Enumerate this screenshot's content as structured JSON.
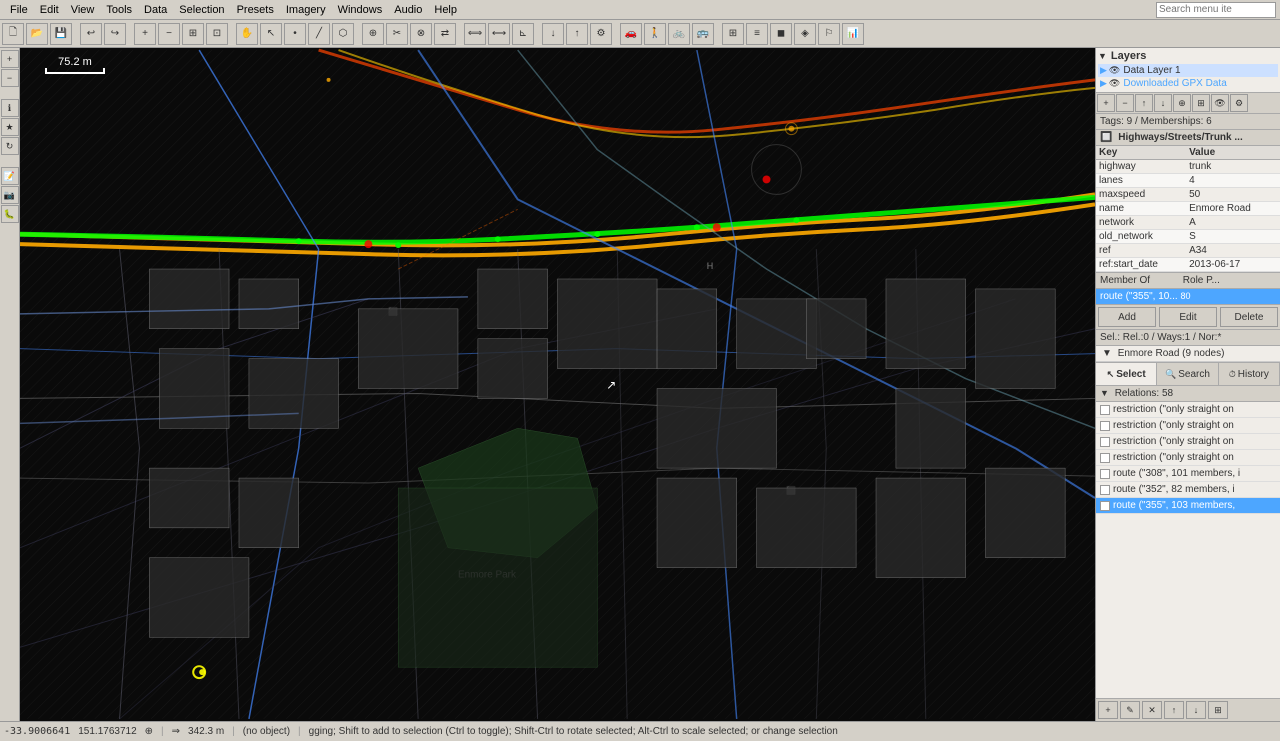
{
  "menubar": {
    "items": [
      "File",
      "Edit",
      "View",
      "Tools",
      "Data",
      "Selection",
      "Presets",
      "Imagery",
      "Windows",
      "Audio",
      "Help"
    ],
    "search_placeholder": "Search menu ite"
  },
  "toolbar": {
    "buttons": [
      "new",
      "open",
      "save",
      "undo",
      "redo",
      "zoom-in",
      "zoom-out",
      "zoom-fit",
      "zoom-sel",
      "hand",
      "select",
      "node",
      "way",
      "relation",
      "merge",
      "split",
      "combine",
      "reverse",
      "align-h",
      "align-v",
      "distribute",
      "ortho",
      "download",
      "upload",
      "preferences",
      "imagery",
      "validator",
      "paintroller",
      "car",
      "pedestrian",
      "bicycle",
      "bus",
      "barrier",
      "icon1",
      "icon2",
      "icon3",
      "icon4",
      "icon5",
      "icon6"
    ]
  },
  "left_toolbar": {
    "buttons": [
      "zoom-in",
      "zoom-out",
      "info",
      "bookmark",
      "rotate",
      "note",
      "photo",
      "bug"
    ]
  },
  "scale": {
    "value": "75.2 m"
  },
  "right_panel": {
    "layers_label": "Layers",
    "layer1": "Data Layer 1",
    "layer2": "Downloaded GPX Data",
    "tags_label": "Tags: 9 / Memberships: 6",
    "highway_label": "Highways/Streets/Trunk ...",
    "properties": [
      {
        "key": "highway",
        "value": "trunk"
      },
      {
        "key": "lanes",
        "value": "4"
      },
      {
        "key": "maxspeed",
        "value": "50"
      },
      {
        "key": "name",
        "value": "Enmore Road"
      },
      {
        "key": "network",
        "value": "A"
      },
      {
        "key": "old_network",
        "value": "S"
      },
      {
        "key": "ref",
        "value": "A34"
      },
      {
        "key": "ref:start_date",
        "value": "2013-06-17"
      }
    ],
    "member_of_label": "Member Of",
    "role_label": "Role P...",
    "member_item": "route (\"355\", 10...",
    "member_value": "80",
    "add_label": "Add",
    "edit_label": "Edit",
    "delete_label": "Delete",
    "sel_info": "Sel.: Rel.:0 / Ways:1 / Nor:*",
    "enmore_road": "Enmore Road (9 nodes)",
    "tabs": {
      "select": "Select",
      "search": "Search",
      "history": "History"
    },
    "relations_label": "Relations: 58",
    "relations": [
      {
        "text": "restriction (\"only straight on",
        "selected": false
      },
      {
        "text": "restriction (\"only straight on",
        "selected": false
      },
      {
        "text": "restriction (\"only straight on",
        "selected": false
      },
      {
        "text": "restriction (\"only straight on",
        "selected": false
      },
      {
        "text": "route (\"308\", 101 members, i",
        "selected": false
      },
      {
        "text": "route (\"352\", 82 members, i",
        "selected": false
      },
      {
        "text": "route (\"355\", 103 members,",
        "selected": true
      }
    ]
  },
  "statusbar": {
    "coords": "-33.9006641",
    "lon": "151.1763712",
    "gps_icon": "⊕",
    "arrow": "⇒",
    "distance": "342.3 m",
    "object": "(no object)",
    "hint": "gging; Shift to add to selection (Ctrl to toggle); Shift-Ctrl to rotate selected; Alt-Ctrl to scale selected; or change selection"
  },
  "colors": {
    "accent_blue": "#4da6ff",
    "panel_bg": "#f0ede8",
    "toolbar_bg": "#d4d0c8",
    "selected_row": "#4da6ff"
  }
}
